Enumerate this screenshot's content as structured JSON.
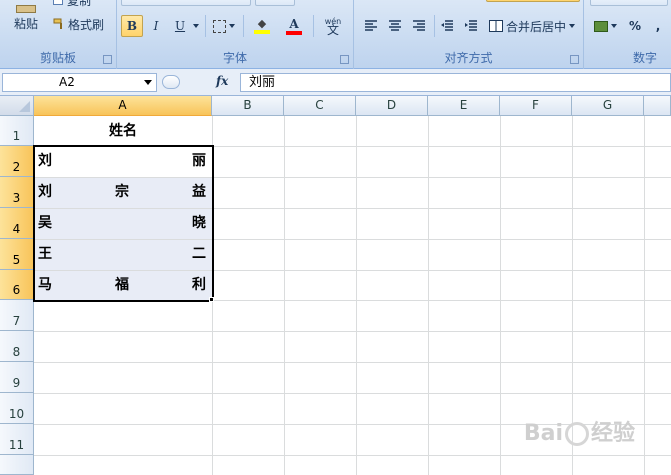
{
  "ribbon": {
    "clipboard": {
      "paste_label": "粘贴",
      "copy_label": "复制",
      "format_painter_label": "格式刷",
      "group_label": "剪贴板"
    },
    "font": {
      "bold": "B",
      "italic": "I",
      "underline": "U",
      "font_color_letter": "A",
      "phonetic_label": "wén",
      "group_label": "字体"
    },
    "alignment": {
      "merge_center_label": "合并后居中",
      "group_label": "对齐方式"
    },
    "number": {
      "percent": "%",
      "group_label": "数字"
    }
  },
  "formula_bar": {
    "name_box": "A2",
    "fx_label": "fx",
    "formula_value": "刘丽"
  },
  "sheet": {
    "columns": [
      "A",
      "B",
      "C",
      "D",
      "E",
      "F",
      "G"
    ],
    "rows": [
      "1",
      "2",
      "3",
      "4",
      "5",
      "6",
      "7",
      "8",
      "9",
      "10",
      "11"
    ],
    "header": "姓名",
    "names": [
      {
        "c1": "刘",
        "c2": "",
        "c3": "丽"
      },
      {
        "c1": "刘",
        "c2": "宗",
        "c3": "益"
      },
      {
        "c1": "吴",
        "c2": "",
        "c3": "晓"
      },
      {
        "c1": "王",
        "c2": "",
        "c3": "二"
      },
      {
        "c1": "马",
        "c2": "福",
        "c3": "利"
      }
    ]
  },
  "watermark": {
    "left": "Bai",
    "right": "经验"
  },
  "colors": {
    "accent": "#f8c45a",
    "ribbon": "#c9dbf1",
    "selection_fill": "#e8ecf6"
  }
}
